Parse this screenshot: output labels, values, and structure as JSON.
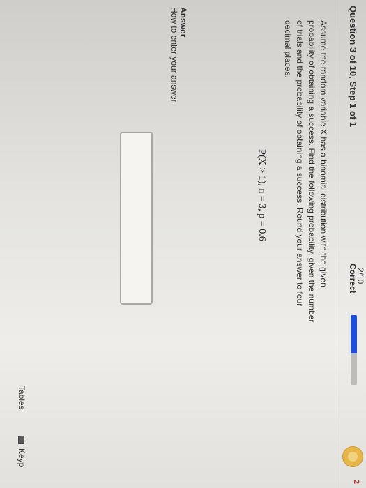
{
  "header": {
    "question_label": "Question 3 of 10, Step 1 of 1",
    "score_fraction": "2/10",
    "score_status": "Correct",
    "progress": 0.55,
    "edge_tag": "2"
  },
  "question": {
    "prompt": "Assume the random variable X has a binomial distribution with the given probability of obtaining a success. Find the following probability, given the number of trials and the probability of obtaining a success. Round your answer to four decimal places.",
    "formula": "P(X > 1), n = 3, p = 0.6"
  },
  "answer": {
    "label": "Answer",
    "help_link": "How to enter your answer",
    "input_value": ""
  },
  "tools": {
    "tables_label": "Tables",
    "keypad_label": "Keyp",
    "keypad_icon": "keypad-icon"
  },
  "colors": {
    "progress_fill": "#1f4fd8",
    "avatar": "#e6b64a"
  }
}
